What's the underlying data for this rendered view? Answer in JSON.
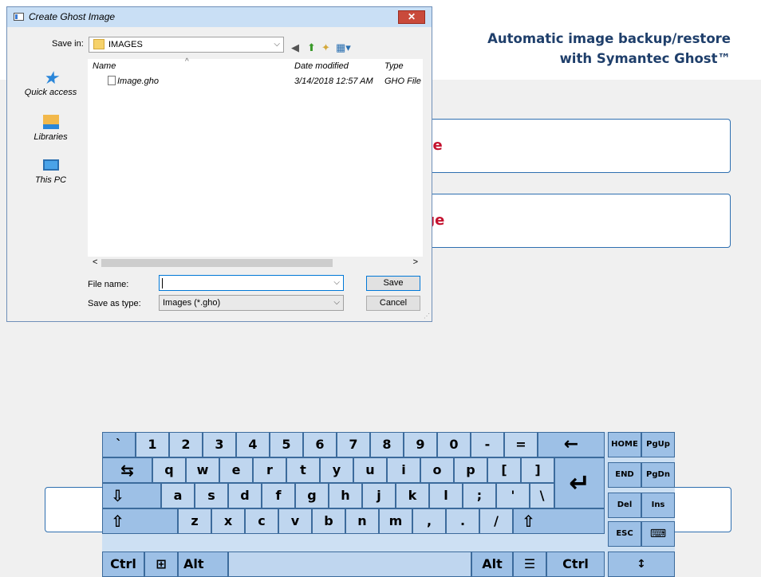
{
  "app": {
    "title_line1": "Automatic image backup/restore",
    "title_line2": "with Symantec Ghost™",
    "button1_label": "Create Ghost Image",
    "button2_label": "Restore Ghost Image"
  },
  "dialog": {
    "title": "Create Ghost Image",
    "close_glyph": "✕",
    "save_in_label": "Save in:",
    "save_in_value": "IMAGES",
    "toolbar_icons": [
      "back-icon",
      "up-folder-icon",
      "new-folder-icon",
      "view-menu-icon"
    ],
    "places": [
      "Quick access",
      "Libraries",
      "This PC"
    ],
    "columns": {
      "name": "Name",
      "date": "Date modified",
      "type": "Type"
    },
    "files": [
      {
        "name": "Image.gho",
        "date": "3/14/2018 12:57 AM",
        "type": "GHO File"
      }
    ],
    "scroll_left": "<",
    "scroll_right": ">",
    "file_name_label": "File name:",
    "file_name_value": "",
    "save_as_type_label": "Save as type:",
    "save_as_type_value": "Images (*.gho)",
    "save_button": "Save",
    "cancel_button": "Cancel"
  },
  "keyboard": {
    "row1": [
      "`",
      "1",
      "2",
      "3",
      "4",
      "5",
      "6",
      "7",
      "8",
      "9",
      "0",
      "-",
      "=",
      "←"
    ],
    "row2": [
      "⇆",
      "q",
      "w",
      "e",
      "r",
      "t",
      "y",
      "u",
      "i",
      "o",
      "p",
      "[",
      "]"
    ],
    "row3": [
      "⇩",
      "a",
      "s",
      "d",
      "f",
      "g",
      "h",
      "j",
      "k",
      "l",
      ";",
      "'",
      "\\"
    ],
    "row4": [
      "⇧",
      "z",
      "x",
      "c",
      "v",
      "b",
      "n",
      "m",
      ",",
      ".",
      "/",
      "⇧"
    ],
    "row5": {
      "ctrl_left": "Ctrl",
      "win": "⊞",
      "alt_left": "Alt",
      "space": "",
      "alt_right": "Alt",
      "menu": "☰",
      "ctrl_right": "Ctrl"
    },
    "enter": "↵",
    "nav": {
      "home": "HOME",
      "pgup": "PgUp",
      "end": "END",
      "pgdn": "PgDn",
      "del": "Del",
      "ins": "Ins",
      "esc": "ESC",
      "kbd": "⌨",
      "move": "↕"
    }
  }
}
